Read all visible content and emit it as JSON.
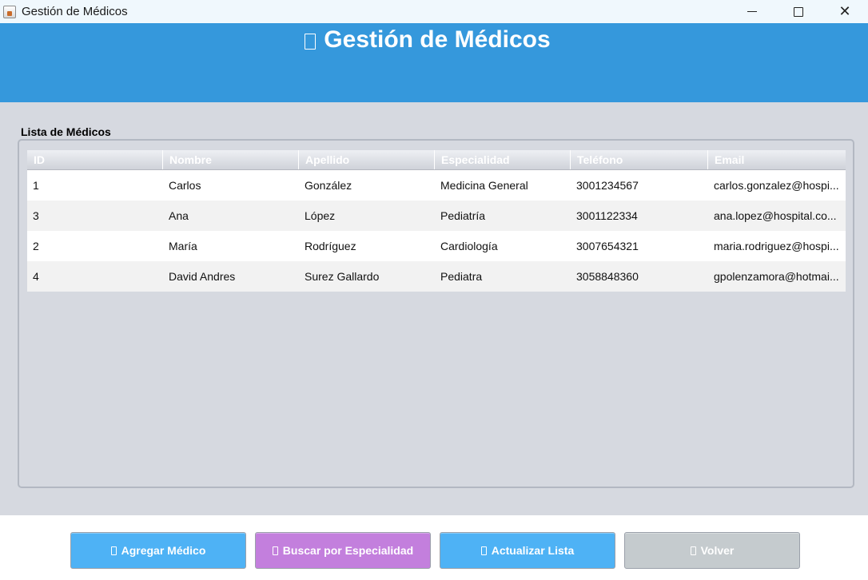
{
  "window": {
    "title": "Gestión de Médicos"
  },
  "header": {
    "title": "Gestión de Médicos"
  },
  "section": {
    "title": "Lista de Médicos"
  },
  "table": {
    "columns": [
      "ID",
      "Nombre",
      "Apellido",
      "Especialidad",
      "Teléfono",
      "Email"
    ],
    "rows": [
      [
        "1",
        "Carlos",
        "González",
        "Medicina General",
        "3001234567",
        "carlos.gonzalez@hospi..."
      ],
      [
        "3",
        "Ana",
        "López",
        "Pediatría",
        "3001122334",
        "ana.lopez@hospital.co..."
      ],
      [
        "2",
        "María",
        "Rodríguez",
        "Cardiología",
        "3007654321",
        "maria.rodriguez@hospi..."
      ],
      [
        "4",
        "David Andres",
        "Surez Gallardo",
        "Pediatra",
        "3058848360",
        "gpolenzamora@hotmai..."
      ]
    ]
  },
  "buttons": {
    "add": "Agregar Médico",
    "search": "Buscar por Especialidad",
    "refresh": "Actualizar Lista",
    "back": "Volver"
  },
  "colors": {
    "header": "#3598dc",
    "content": "#d6d9e0",
    "button_blue": "#4eb2f5",
    "button_purple": "#c37fdd",
    "button_gray": "#c5cbce"
  },
  "icons": {
    "app": "java-app-icon",
    "minimize": "minimize-icon",
    "maximize": "maximize-icon",
    "close": "close-icon",
    "missing_glyph": "missing-glyph-icon"
  }
}
